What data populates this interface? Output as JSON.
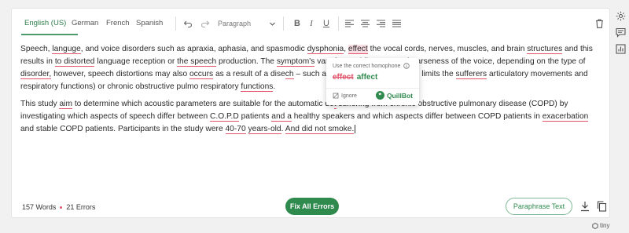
{
  "toolbar": {
    "languages": [
      "English (US)",
      "German",
      "French",
      "Spanish"
    ],
    "paragraph_select": "Paragraph",
    "bold": "B",
    "italic": "I",
    "underline": "U"
  },
  "content": {
    "p1": [
      "Speech, ",
      "languge",
      ", and voice disorders such as apraxia, aphasia, and spasmodic ",
      "dysphonia",
      ", ",
      "effect",
      " the vocal cords, nerves, muscles, and brain ",
      "structures",
      " and this results in ",
      "to distorted",
      " language reception or ",
      "the speech",
      " production. The ",
      "symptom's",
      " vary from addi",
      " pauses to hoarseness of the voice, depending on the type of ",
      "disorder,",
      " however, speech distortions may also ",
      "occurs",
      " as a result of a dise",
      "ch",
      " – such as multiple sclerosis (which limits the ",
      "sufferers",
      " articulatory movements and respiratory functions) or chronic obstructive pulmo",
      " respiratory ",
      "functions",
      "."
    ],
    "p2": [
      "This study ",
      "aim",
      " to determine which acoustic parameters are suitable for the automatic de",
      "t",
      " suffering from chronic obstructive pulmonary disease (COPD) by investigating which aspects of speech differ between ",
      "C.O.P.D",
      " patients ",
      "and a",
      " healthy speakers and which aspects differ between COPD patients in ",
      "exacerbation",
      " and stable COPD patients. Participants in the study were ",
      "40-70",
      " ",
      "years-old",
      ". ",
      "And did not smoke.",
      ""
    ]
  },
  "footer": {
    "words": "157 Words",
    "errors": "21 Errors",
    "fix_all": "Fix All Errors",
    "paraphrase": "Paraphrase Text"
  },
  "popup": {
    "title": "Use the correct homophone",
    "old_word": "effect",
    "new_word": "affect",
    "ignore": "Ignore",
    "brand": "QuillBot"
  },
  "tiny_label": "tiny",
  "colors": {
    "accent": "#2f8a4e",
    "error": "#e0536a"
  }
}
